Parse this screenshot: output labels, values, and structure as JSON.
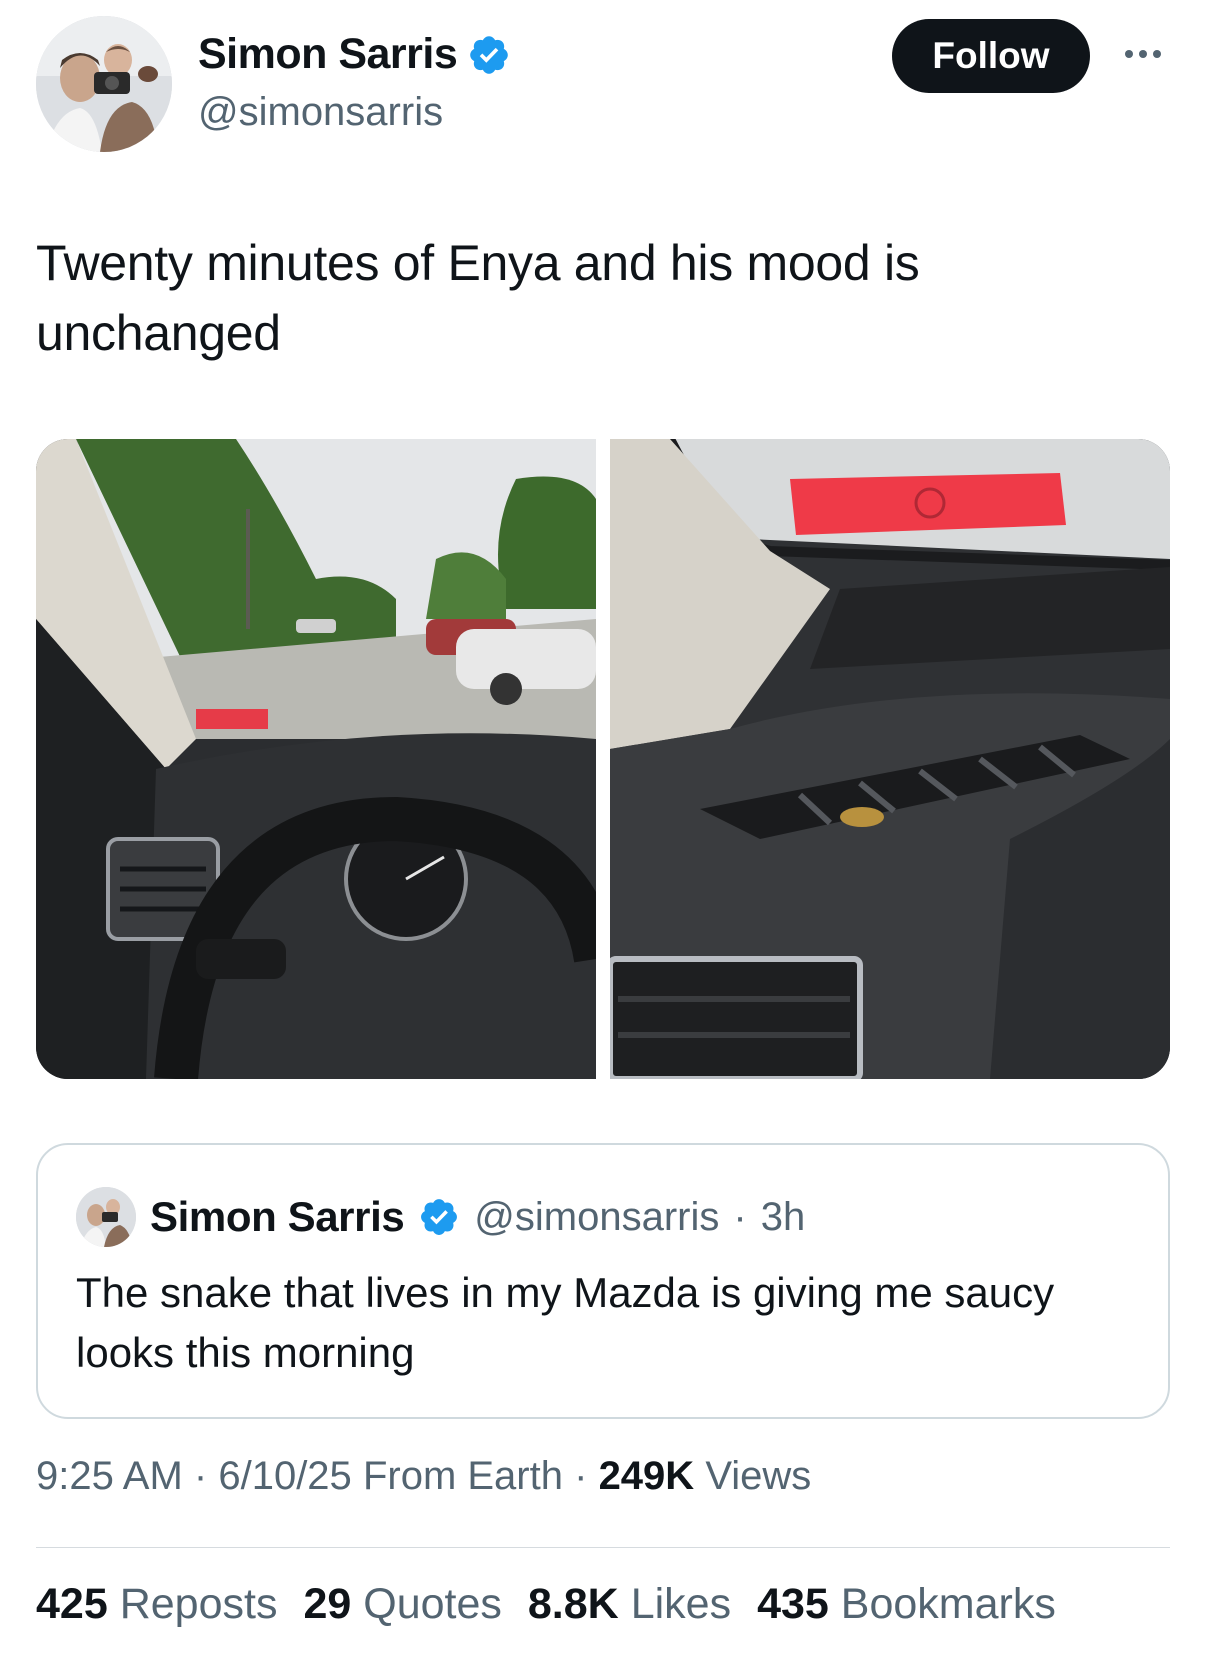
{
  "author": {
    "name": "Simon Sarris",
    "handle": "@simonsarris",
    "verified": true
  },
  "header": {
    "follow_label": "Follow"
  },
  "tweet": {
    "text": "Twenty minutes of Enya and his mood is unchanged"
  },
  "quoted_tweet": {
    "name": "Simon Sarris",
    "handle": "@simonsarris",
    "separator": "·",
    "time": "3h",
    "text": "The snake that lives in my Mazda is giving me saucy looks this morning"
  },
  "meta": {
    "time": "9:25 AM",
    "separator": "·",
    "date": "6/10/25",
    "source": "From Earth",
    "views_count": "249K",
    "views_label": "Views"
  },
  "stats": [
    {
      "count": "425",
      "label": "Reposts"
    },
    {
      "count": "29",
      "label": "Quotes"
    },
    {
      "count": "8.8K",
      "label": "Likes"
    },
    {
      "count": "435",
      "label": "Bookmarks"
    }
  ],
  "colors": {
    "text": "#0f1419",
    "secondary": "#536471",
    "verified": "#1d9bf0",
    "border": "#cfd9de"
  },
  "icons": {
    "verified": "verified-badge-icon",
    "more": "more-dots-icon"
  }
}
